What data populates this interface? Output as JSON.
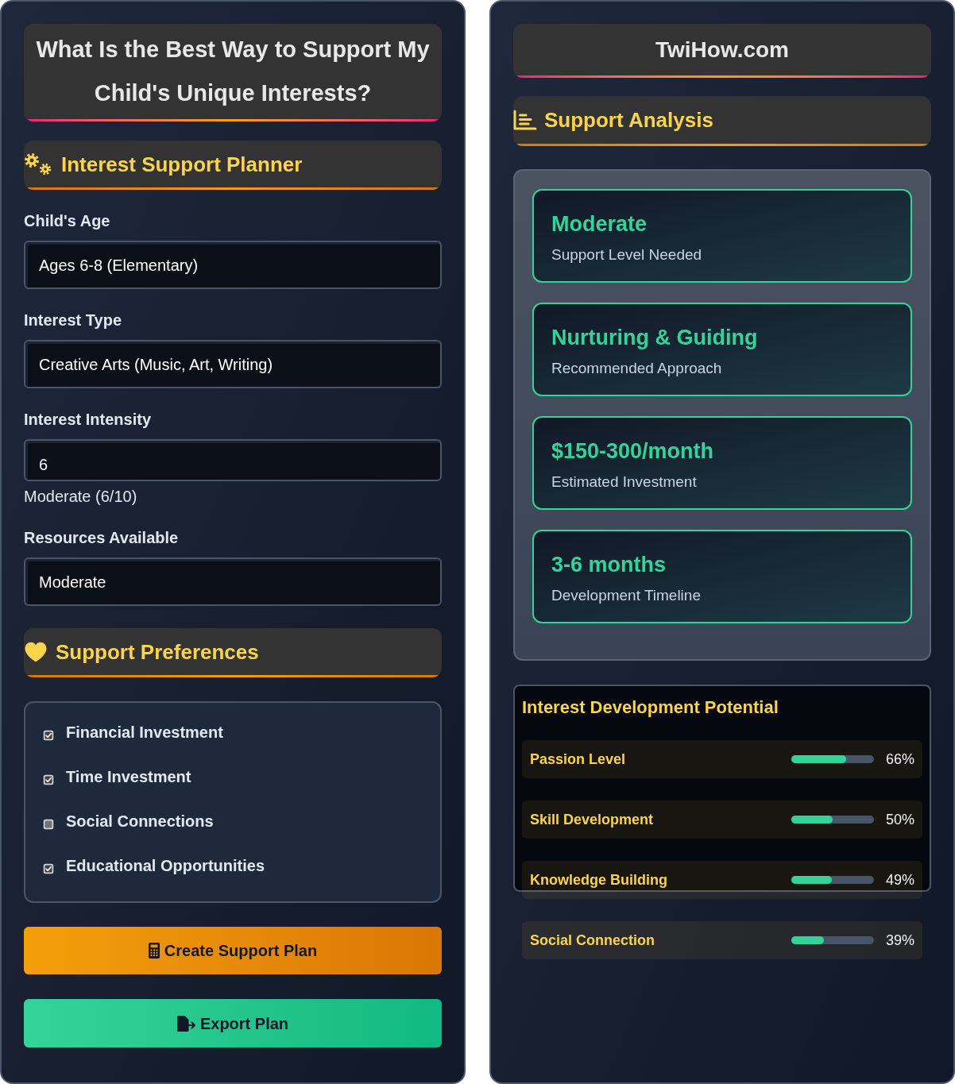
{
  "planner": {
    "title": "What Is the Best Way to Support My Child's Unique Interests?",
    "section_title": "Interest Support Planner",
    "fields": [
      {
        "kind": "select",
        "label": "Child's Age",
        "value": "Ages 6-8 (Elementary)"
      },
      {
        "kind": "select",
        "label": "Interest Type",
        "value": "Creative Arts (Music, Art, Writing)"
      },
      {
        "kind": "number",
        "label": "Interest Intensity",
        "value": "6",
        "reading": "Moderate (6/10)"
      },
      {
        "kind": "select",
        "label": "Resources Available",
        "value": "Moderate"
      }
    ],
    "preferences": {
      "title": "Support Preferences",
      "options": [
        {
          "label": "Financial Investment",
          "checked": true
        },
        {
          "label": "Time Investment",
          "checked": true
        },
        {
          "label": "Social Connections",
          "checked": false
        },
        {
          "label": "Educational Opportunities",
          "checked": true
        }
      ]
    },
    "buttons": [
      {
        "kind": "calculate",
        "label": "Create Support Plan"
      },
      {
        "kind": "export",
        "label": "Export Plan"
      }
    ]
  },
  "analysis": {
    "site": "TwiHow.com",
    "title": "Support Analysis",
    "results": [
      {
        "value": "Moderate",
        "label": "Support Level Needed"
      },
      {
        "value": "Nurturing & Guiding",
        "label": "Recommended Approach"
      },
      {
        "value": "$150-300/month",
        "label": "Estimated Investment"
      },
      {
        "value": "3-6 months",
        "label": "Development Timeline"
      }
    ],
    "potential": {
      "title": "Interest Development Potential",
      "metrics": [
        {
          "label": "Passion Level",
          "level": 0.66,
          "reading": "66%"
        },
        {
          "label": "Skill Development",
          "level": 0.5,
          "reading": "50%"
        },
        {
          "label": "Knowledge Building",
          "level": 0.49,
          "reading": "49%"
        },
        {
          "label": "Social Connection",
          "level": 0.39,
          "reading": "39%"
        }
      ]
    }
  }
}
